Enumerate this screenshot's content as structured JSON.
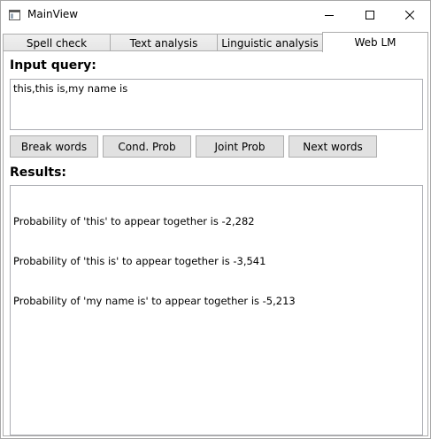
{
  "window": {
    "title": "MainView"
  },
  "tabs": [
    {
      "label": "Spell check",
      "selected": false
    },
    {
      "label": "Text analysis",
      "selected": false
    },
    {
      "label": "Linguistic analysis",
      "selected": false
    },
    {
      "label": "Web LM",
      "selected": true
    }
  ],
  "input": {
    "label": "Input query:",
    "value": "this,this is,my name is"
  },
  "buttons": {
    "break_words": "Break words",
    "cond_prob": "Cond. Prob",
    "joint_prob": "Joint Prob",
    "next_words": "Next words"
  },
  "results": {
    "label": "Results:",
    "lines": [
      "Probability of 'this' to appear together is -2,282",
      "Probability of 'this is' to appear together is -3,541",
      "Probability of 'my name is' to appear together is -5,213"
    ]
  },
  "icons": {
    "app": "window-app-icon",
    "minimize": "minimize-icon",
    "maximize": "maximize-icon",
    "close": "close-icon"
  }
}
